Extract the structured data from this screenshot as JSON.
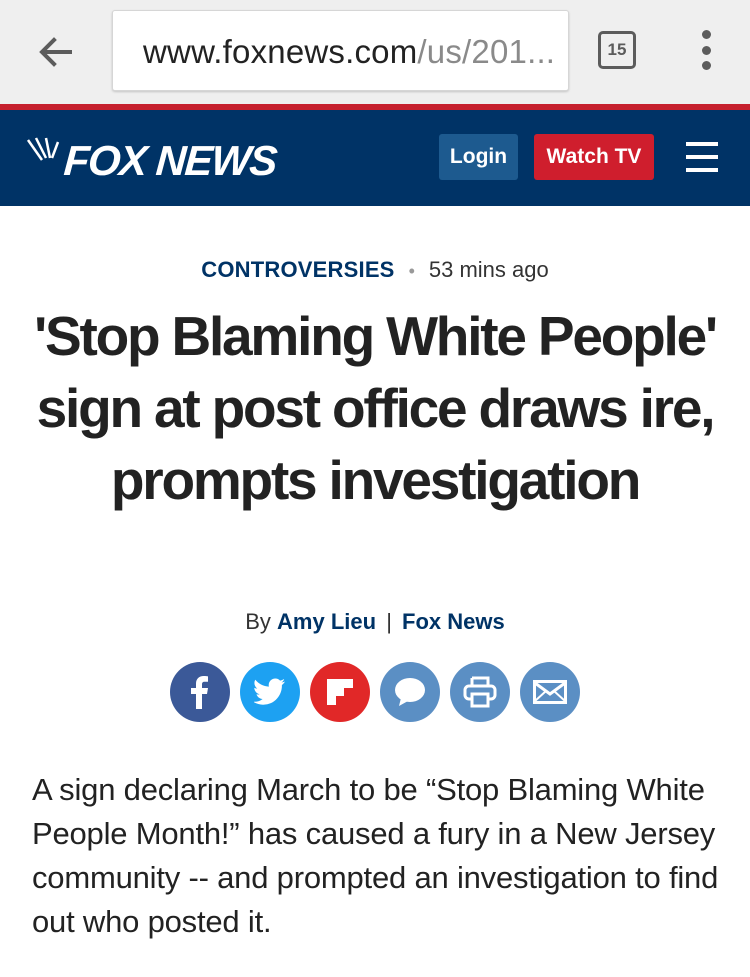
{
  "browser": {
    "url_domain": "www.foxnews.com",
    "url_path": "/us/201...",
    "tab_count": "15"
  },
  "site": {
    "logo_text": "FOX NEWS",
    "login_label": "Login",
    "watch_label": "Watch TV"
  },
  "article": {
    "category": "CONTROVERSIES",
    "time": "53 mins ago",
    "headline": "'Stop Blaming White People' sign at post office draws ire, prompts investigation",
    "by": "By",
    "author": "Amy Lieu",
    "separator": "|",
    "source": "Fox News",
    "body": "A sign declaring March to be “Stop Blaming White People Month!” has caused a fury in a New Jersey community -- and prompted an investigation to find out who posted it."
  },
  "share": {
    "icons": [
      "facebook-icon",
      "twitter-icon",
      "flipboard-icon",
      "comment-icon",
      "print-icon",
      "email-icon"
    ]
  },
  "colors": {
    "brand_navy": "#003366",
    "brand_red": "#c6202e",
    "watch_red": "#cf1e2d",
    "facebook": "#3b5998",
    "twitter": "#1da1f2",
    "flipboard": "#e12828",
    "share_blue": "#5b8fc4"
  }
}
